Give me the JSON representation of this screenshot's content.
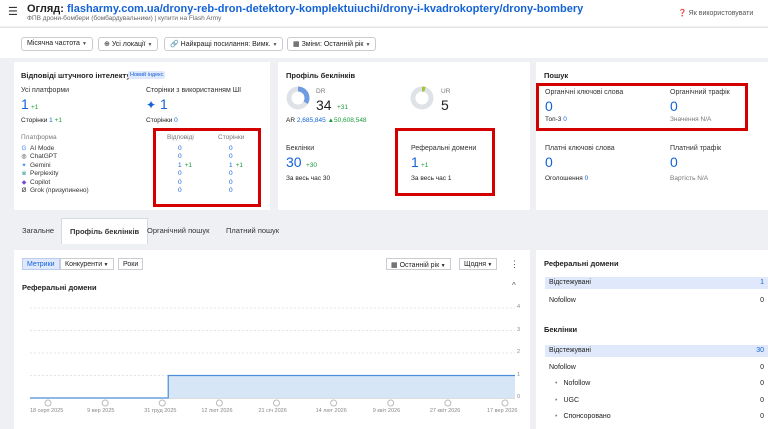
{
  "header": {
    "title_prefix": "Огляд:",
    "url": "flasharmy.com.ua/drony-reb-dron-detektory-komplektuiuchi/drony-i-kvadrokoptery/drony-bombery",
    "subtitle": "ФПВ дрони-бомбери (бомбардувальники) | купити на Flash Army",
    "help_label": "Як використовувати"
  },
  "filters": [
    {
      "label": "Місячна частота"
    },
    {
      "label": "Усі локації"
    },
    {
      "label": "Найкращі посилання: Вимк."
    },
    {
      "label": "Зміни: Останній рік"
    }
  ],
  "ai_panel": {
    "title": "Відповіді штучного інтелекту",
    "badge": "Новий індекс",
    "all_platforms_label": "Усі платформи",
    "all_platforms_value": "1",
    "all_platforms_delta": "+1",
    "pages_label": "Сторінки",
    "pages_value": "1",
    "pages_delta": "+1",
    "pages_ai_label": "Сторінки з використанням ШІ",
    "pages_ai_value": "1",
    "pages_ai_sub_label": "Сторінки",
    "pages_ai_sub_value": "0",
    "platform_header": "Платформа",
    "answers_header": "Відповіді",
    "pages_header": "Сторінки",
    "platforms": [
      {
        "icon": "G",
        "name": "AI Mode",
        "answers": "0",
        "answers_delta": "",
        "pages": "0",
        "pages_delta": ""
      },
      {
        "icon": "◎",
        "name": "ChatGPT",
        "answers": "0",
        "answers_delta": "",
        "pages": "0",
        "pages_delta": ""
      },
      {
        "icon": "✦",
        "name": "Gemini",
        "answers": "1",
        "answers_delta": "+1",
        "pages": "1",
        "pages_delta": "+1"
      },
      {
        "icon": "※",
        "name": "Perplexity",
        "answers": "0",
        "answers_delta": "",
        "pages": "0",
        "pages_delta": ""
      },
      {
        "icon": "◆",
        "name": "Copilot",
        "answers": "0",
        "answers_delta": "",
        "pages": "0",
        "pages_delta": ""
      },
      {
        "icon": "Ø",
        "name": "Grok (призупинено)",
        "answers": "0",
        "answers_delta": "",
        "pages": "0",
        "pages_delta": ""
      }
    ]
  },
  "backlink_profile": {
    "title": "Профіль беклінків",
    "dr_label": "DR",
    "dr_value": "34",
    "dr_delta": "+31",
    "ur_label": "UR",
    "ur_value": "5",
    "ar_label": "AR",
    "ar_value": "2,685,845",
    "ar_delta": "▲50,608,548",
    "backlinks_label": "Беклінки",
    "backlinks_value": "30",
    "backlinks_delta": "+30",
    "backlinks_all_time_label": "За весь час",
    "backlinks_all_time_value": "30",
    "ref_domains_label": "Реферальні домени",
    "ref_domains_value": "1",
    "ref_domains_delta": "+1",
    "ref_all_time_label": "За весь час",
    "ref_all_time_value": "1"
  },
  "search": {
    "title": "Пошук",
    "organic_kw_label": "Органічні ключові слова",
    "organic_kw_value": "0",
    "top3_label": "Топ-3",
    "top3_value": "0",
    "organic_traffic_label": "Органічний трафік",
    "organic_traffic_value": "0",
    "traffic_value_label": "Значення N/A",
    "paid_kw_label": "Платні ключові слова",
    "paid_kw_value": "0",
    "ads_label": "Оголошення",
    "ads_value": "0",
    "paid_traffic_label": "Платний трафік",
    "paid_traffic_value": "0",
    "paid_cost_label": "Вартість N/A"
  },
  "tabs": [
    "Загальне",
    "Профіль беклінків",
    "Органічний пошук",
    "Платний пошук"
  ],
  "chart_controls": {
    "metrics": "Метрики",
    "competitors": "Конкуренти",
    "years": "Роки",
    "period": "Останній рік",
    "interval": "Щодня",
    "more": "⋮"
  },
  "chart_data": {
    "type": "area",
    "title": "Реферальні домени",
    "x": [
      "18 серп 2025",
      "9 вер 2025",
      "31 груд 2025",
      "12 лют 2026",
      "21 січ 2026",
      "14 лют 2026",
      "9 квіт 2026",
      "27 квіт 2026",
      "17 вер 2026"
    ],
    "y_ticks": [
      "4",
      "3",
      "2",
      "1",
      "0"
    ],
    "ylim": [
      0,
      4
    ],
    "series": [
      {
        "values": [
          0,
          0,
          1,
          1,
          1,
          1,
          1,
          1,
          1
        ]
      }
    ],
    "step_x": 0.285
  },
  "right_panel": {
    "ref_domains_title": "Реферальні домени",
    "ref_rows": [
      {
        "name": "Відстежувані",
        "value": "1",
        "highlight": true
      },
      {
        "name": "Nofollow",
        "value": "0",
        "highlight": false
      }
    ],
    "backlinks_title": "Беклінки",
    "bl_rows": [
      {
        "name": "Відстежувані",
        "value": "30",
        "highlight": true
      },
      {
        "name": "Nofollow",
        "value": "0",
        "highlight": false
      },
      {
        "name": "Nofollow",
        "value": "0",
        "highlight": false,
        "indent": true
      },
      {
        "name": "UGC",
        "value": "0",
        "highlight": false,
        "indent": true
      },
      {
        "name": "Спонсоровано",
        "value": "0",
        "highlight": false,
        "indent": true
      }
    ]
  },
  "colors": {
    "accent": "#1463d6",
    "positive": "#1a9c3a",
    "highlight_box": "#d40000",
    "area_fill": "#d6e6f7"
  }
}
